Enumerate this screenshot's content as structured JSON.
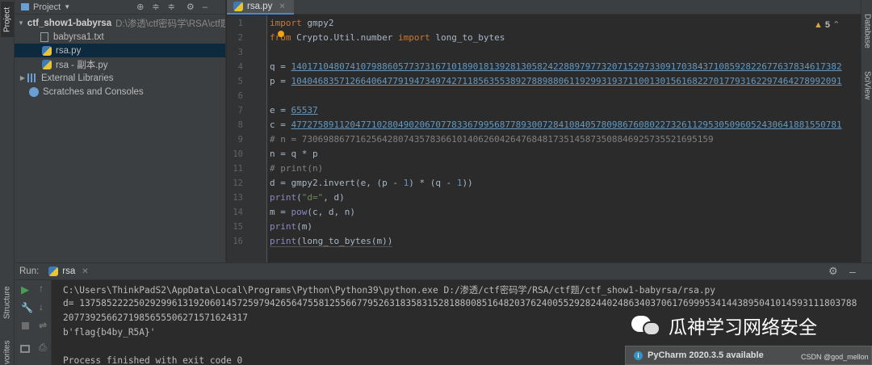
{
  "left_strip": {
    "project_tab": "Project",
    "structure_tab": "Structure",
    "favorites_tab": "vorites"
  },
  "right_strip": {
    "database_tab": "Database",
    "sciview_tab": "SciView"
  },
  "project_panel": {
    "title": "Project",
    "tree": [
      {
        "label": "ctf_show1-babyrsa",
        "path": "D:\\渗透\\ctf密码学\\RSA\\ctf题",
        "type": "folder"
      },
      {
        "label": "babyrsa1.txt",
        "type": "text"
      },
      {
        "label": "rsa.py",
        "type": "python",
        "selected": true
      },
      {
        "label": "rsa - 副本.py",
        "type": "python"
      },
      {
        "label": "External Libraries",
        "type": "library"
      },
      {
        "label": "Scratches and Consoles",
        "type": "scratch"
      }
    ]
  },
  "editor": {
    "tab_label": "rsa.py",
    "warnings": "5",
    "line_numbers": [
      "1",
      "2",
      "3",
      "4",
      "5",
      "6",
      "7",
      "8",
      "9",
      "10",
      "11",
      "12",
      "13",
      "14",
      "15",
      "16"
    ],
    "lines": {
      "l1_kw": "import",
      "l1_rest": " gmpy2",
      "l2_kw1": "from",
      "l2_mod": " Crypto.Util.number ",
      "l2_kw2": "import",
      "l2_rest": " long_to_bytes",
      "l4_lhs": "q = ",
      "l4_val": "1401710480741079886057737316710189018139281305824228897977320715297330917038437108592822677637834617382",
      "l5_lhs": "p = ",
      "l5_val": "1040468357126640647791947349742711856355389278898806119299319371100130156168227017793162297464278992091",
      "l7_lhs": "e = ",
      "l7_val": "65537",
      "l8_lhs": "c = ",
      "l8_val": "4772758911204771028049020670778336799568778930072841084057809867608022732611295305096052430641881550781",
      "l9": "# n = 73069886771625642807435783661014062604264768481735145873508846925735521695159",
      "l10": "n = q * p",
      "l11": "# print(n)",
      "l12_a": "d = gmpy2.invert(e, (p - ",
      "l12_n1": "1",
      "l12_b": ") * (q - ",
      "l12_n2": "1",
      "l12_c": "))",
      "l13_fn": "print",
      "l13_a": "(",
      "l13_str": "\"d=\"",
      "l13_b": ", d)",
      "l14_a": "m = ",
      "l14_fn": "pow",
      "l14_b": "(c, d, n)",
      "l15_fn": "print",
      "l15_b": "(m)",
      "l16_fn": "print",
      "l16_b": "(long_to_bytes(m))"
    }
  },
  "run_panel": {
    "label": "Run:",
    "tab_label": "rsa",
    "console": [
      "C:\\Users\\ThinkPadS2\\AppData\\Local\\Programs\\Python\\Python39\\python.exe D:/渗透/ctf密码学/RSA/ctf题/ctf_show1-babyrsa/rsa.py",
      "d= 13758522225029299613192060145725979426564755812556677952631835831528188008516482037624005529282440248634037061769995341443895041014593111803788",
      "2077392566271985655506271571624317",
      "b'flag{b4by_R5A}'",
      "",
      "Process finished with exit code 0"
    ]
  },
  "watermark": {
    "text": "瓜神学习网络安全"
  },
  "notification": {
    "text": "PyCharm 2020.3.5 available",
    "credit": "CSDN @god_mellon"
  },
  "colors": {
    "accent": "#4a88c7",
    "keyword": "#cc7832",
    "number": "#6897bb",
    "string": "#6a8759",
    "comment": "#808080",
    "run": "#499c54"
  }
}
